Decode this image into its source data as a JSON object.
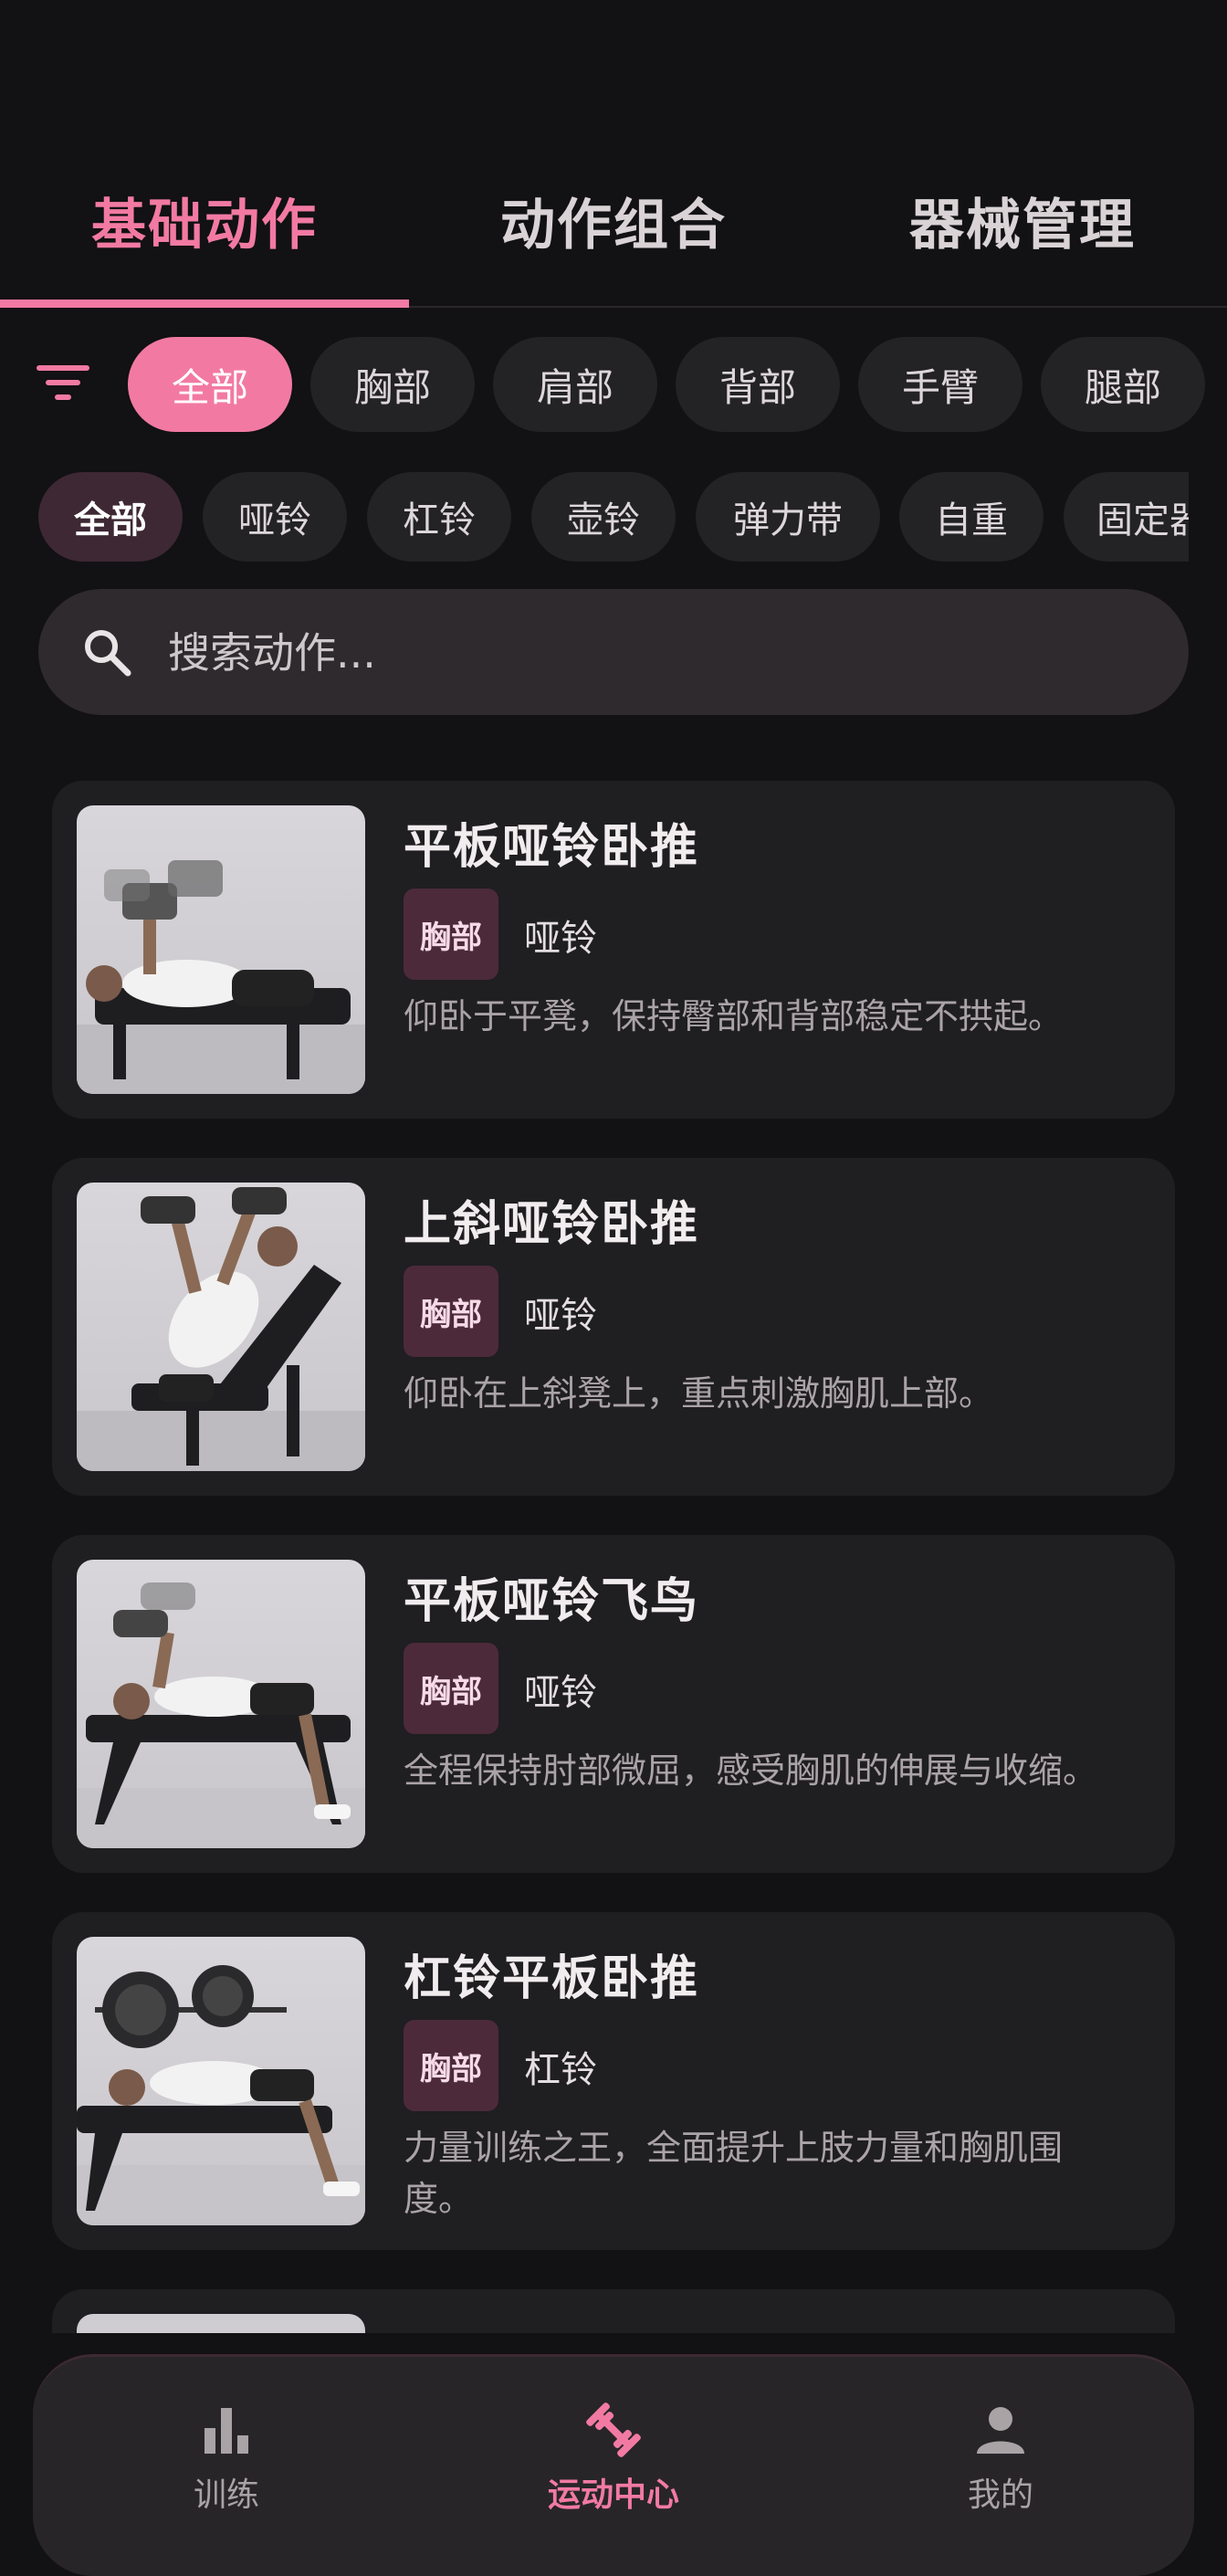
{
  "tabs": [
    {
      "label": "基础动作",
      "active": true
    },
    {
      "label": "动作组合",
      "active": false
    },
    {
      "label": "器械管理",
      "active": false
    }
  ],
  "body_filters": [
    "全部",
    "胸部",
    "肩部",
    "背部",
    "手臂",
    "腿部"
  ],
  "equipment_filters": [
    "全部",
    "哑铃",
    "杠铃",
    "壶铃",
    "弹力带",
    "自重",
    "固定器"
  ],
  "search": {
    "placeholder": "搜索动作..."
  },
  "exercises": [
    {
      "name": "平板哑铃卧推",
      "body_part": "胸部",
      "equipment": "哑铃",
      "description": "仰卧于平凳，保持臀部和背部稳定不拱起。"
    },
    {
      "name": "上斜哑铃卧推",
      "body_part": "胸部",
      "equipment": "哑铃",
      "description": "仰卧在上斜凳上，重点刺激胸肌上部。"
    },
    {
      "name": "平板哑铃飞鸟",
      "body_part": "胸部",
      "equipment": "哑铃",
      "description": "全程保持肘部微屈，感受胸肌的伸展与收缩。"
    },
    {
      "name": "杠铃平板卧推",
      "body_part": "胸部",
      "equipment": "杠铃",
      "description": "力量训练之王，全面提升上肢力量和胸肌围度。"
    }
  ],
  "nav": [
    {
      "label": "训练",
      "icon": "bar-chart-icon",
      "active": false
    },
    {
      "label": "运动中心",
      "icon": "dumbbell-icon",
      "active": true
    },
    {
      "label": "我的",
      "icon": "person-icon",
      "active": false
    }
  ],
  "colors": {
    "accent": "#f27aa2",
    "background": "#121113",
    "card": "#1f1e20",
    "badge": "#4c2a3a"
  }
}
